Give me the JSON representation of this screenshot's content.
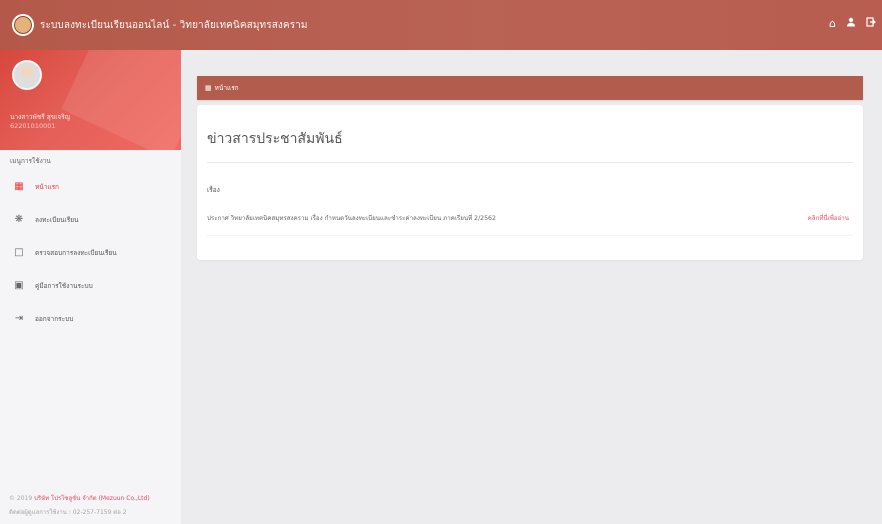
{
  "header": {
    "title": "ระบบลงทะเบียนเรียนออนไลน์ - วิทยาลัยเทคนิคสมุทรสงคราม",
    "icons": [
      "home-icon",
      "user-icon",
      "logout-icon"
    ]
  },
  "profile": {
    "name": "นางสาวพัชรี สุขเจริญ",
    "student_id": "62201010001"
  },
  "sidebar": {
    "heading": "เมนูการใช้งาน",
    "items": [
      {
        "label": "หน้าแรก",
        "icon": "dashboard-icon",
        "active": true
      },
      {
        "label": "ลงทะเบียนเรียน",
        "icon": "gear-icon",
        "active": false
      },
      {
        "label": "ตรวจสอบการลงทะเบียนเรียน",
        "icon": "clipboard-icon",
        "active": false
      },
      {
        "label": "คู่มือการใช้งานระบบ",
        "icon": "book-icon",
        "active": false
      },
      {
        "label": "ออกจากระบบ",
        "icon": "logout-icon",
        "active": false
      }
    ],
    "footer": {
      "line1_prefix": "© 2019",
      "line1_company": "บริษัท โปรโซลูชั่น จำกัด (Mezuun Co.,Ltd)",
      "line2": "ติดต่อผู้ดูแลการใช้งาน : 02-257-7159 ต่อ 2"
    }
  },
  "breadcrumb": {
    "label": "หน้าแรก"
  },
  "news": {
    "title": "ข่าวสารประชาสัมพันธ์",
    "subject_label": "เรื่อง",
    "item_text": "ประกาศ วิทยาลัยเทคนิคสมุทรสงคราม เรื่อง กำหนดวันลงทะเบียนและชำระค่าลงทะเบียน ภาคเรียนที่ 2/2562",
    "read_more": "คลิกที่นี่เพื่ออ่าน"
  },
  "colors": {
    "header": "#b4594a",
    "accent": "#e53a3a",
    "profile_gradient_start": "#d7473d",
    "breadcrumb_bar": "#b25c4e"
  }
}
